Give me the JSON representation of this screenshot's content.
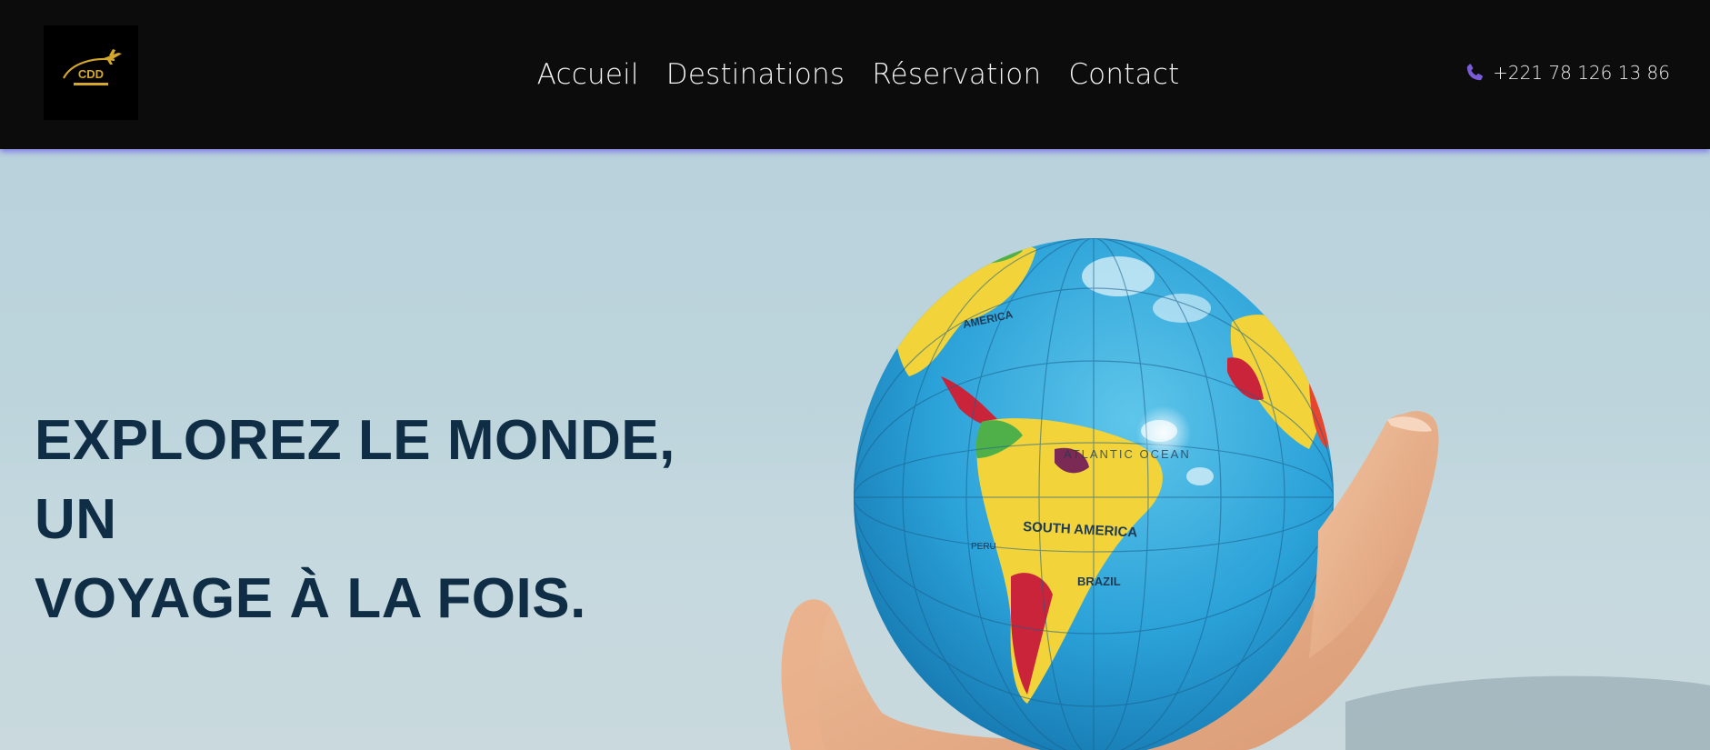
{
  "header": {
    "logo_text": "CDD",
    "nav": [
      {
        "label": "Accueil"
      },
      {
        "label": "Destinations"
      },
      {
        "label": "Réservation"
      },
      {
        "label": "Contact"
      }
    ],
    "phone": "+221 78 126 13 86",
    "colors": {
      "background": "#0c0c0c",
      "accent_shadow": "#786ee6",
      "phone_icon": "#7a5cd6",
      "logo_gold": "#d4a72c"
    }
  },
  "hero": {
    "title_line1": "EXPLOREZ LE MONDE, UN",
    "title_line2": "VOYAGE À LA FOIS.",
    "globe_labels": {
      "north_america": "AMERICA",
      "ocean": "ATLANTIC OCEAN",
      "south_america": "SOUTH AMERICA",
      "brazil": "BRAZIL",
      "peru": "PERU"
    },
    "colors": {
      "title": "#0f2d45",
      "sky": "#bdd4dc"
    }
  }
}
